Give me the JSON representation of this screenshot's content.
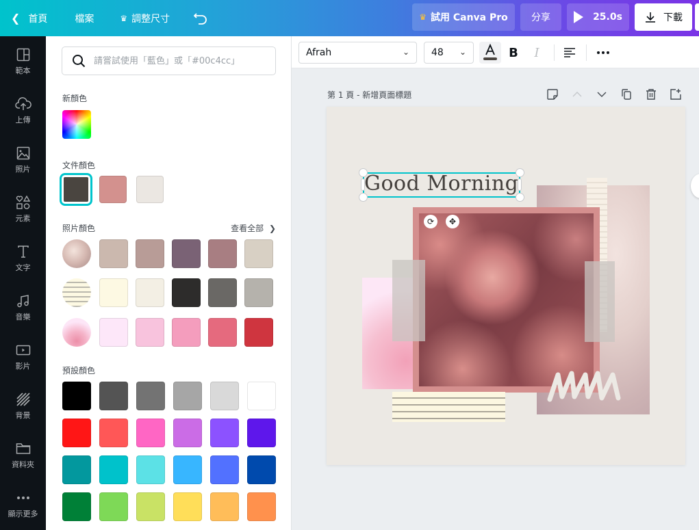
{
  "topbar": {
    "home_label": "首頁",
    "file_label": "檔案",
    "resize_label": "調整尺寸",
    "try_pro_label": "試用 Canva Pro",
    "share_label": "分享",
    "play_duration": "25.0s",
    "download_label": "下載",
    "icons": {
      "back": "chevron-left-icon",
      "crown": "crown-icon",
      "undo": "undo-icon",
      "play": "play-icon",
      "download": "download-icon"
    }
  },
  "rail": {
    "items": [
      {
        "label": "範本",
        "icon": "template-icon"
      },
      {
        "label": "上傳",
        "icon": "upload-cloud-icon"
      },
      {
        "label": "照片",
        "icon": "photo-icon"
      },
      {
        "label": "元素",
        "icon": "elements-icon"
      },
      {
        "label": "文字",
        "icon": "text-icon"
      },
      {
        "label": "音樂",
        "icon": "music-icon"
      },
      {
        "label": "影片",
        "icon": "video-icon"
      },
      {
        "label": "背景",
        "icon": "background-icon"
      },
      {
        "label": "資料夾",
        "icon": "folder-icon"
      },
      {
        "label": "顯示更多",
        "icon": "more-icon"
      }
    ]
  },
  "color_panel": {
    "search_placeholder": "請嘗試使用「藍色」或「#00c4cc」",
    "new_color_title": "新顏色",
    "document_colors_title": "文件顏色",
    "document_colors": [
      "#4a4540",
      "#d3918e",
      "#ebe7e2"
    ],
    "selected_document_color": "#4a4540",
    "photo_colors_title": "照片顏色",
    "see_all_label": "查看全部",
    "photo_color_rows": [
      [
        "#cbb8ae",
        "#b89c97",
        "#7a6275",
        "#a87e82",
        "#d8d0c4"
      ],
      [
        "#fdf9e3",
        "#f3efe4",
        "#2d2c2b",
        "#6a6865",
        "#b5b2ac"
      ],
      [
        "#fde7f9",
        "#f8c3dd",
        "#f49dbd",
        "#e56a7e",
        "#cf353f"
      ]
    ],
    "default_colors_title": "預設顏色",
    "default_color_rows": [
      [
        "#000000",
        "#545454",
        "#737373",
        "#a6a6a6",
        "#d9d9d9",
        "#ffffff"
      ],
      [
        "#ff1616",
        "#ff5757",
        "#ff66c4",
        "#cb6ce6",
        "#8c52ff",
        "#5e17eb"
      ],
      [
        "#03989e",
        "#00c2cb",
        "#5ce1e6",
        "#38b6ff",
        "#5271ff",
        "#004aad"
      ],
      [
        "#008037",
        "#7ed957",
        "#c9e265",
        "#ffde59",
        "#ffbd59",
        "#ff914d"
      ]
    ]
  },
  "text_toolbar": {
    "font_name": "Afrah",
    "font_size": "48",
    "text_color": "#4a4540",
    "icons": [
      "text-color-icon",
      "bold-icon",
      "italic-icon",
      "align-left-icon",
      "more-options-icon"
    ]
  },
  "page": {
    "header": "第 1 頁 - 新增頁面標題",
    "canvas_title_text": "Good Morning",
    "canvas_bg": "#ece9e4",
    "selection_color": "#00c4cc"
  }
}
